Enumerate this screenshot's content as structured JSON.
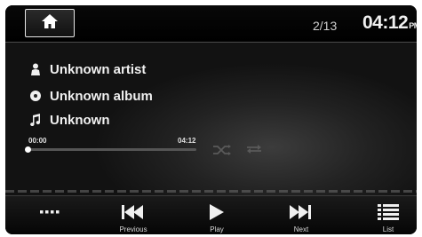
{
  "header": {
    "home_icon": "home-icon",
    "track_index": "2/13",
    "clock_time": "04:12",
    "clock_ampm": "PM"
  },
  "track": {
    "artist": "Unknown artist",
    "album": "Unknown album",
    "title": "Unknown"
  },
  "progress": {
    "elapsed": "00:00",
    "total": "04:12",
    "fraction": 0.0
  },
  "modes": {
    "shuffle_icon": "shuffle-icon",
    "repeat_icon": "repeat-icon"
  },
  "controls": {
    "more_icon": "more-dots-icon",
    "previous_label": "Previous",
    "play_label": "Play",
    "next_label": "Next",
    "list_label": "List"
  },
  "colors": {
    "background": "#1e1e1e",
    "text": "#f0f0f0",
    "accent": "#ffffff"
  }
}
